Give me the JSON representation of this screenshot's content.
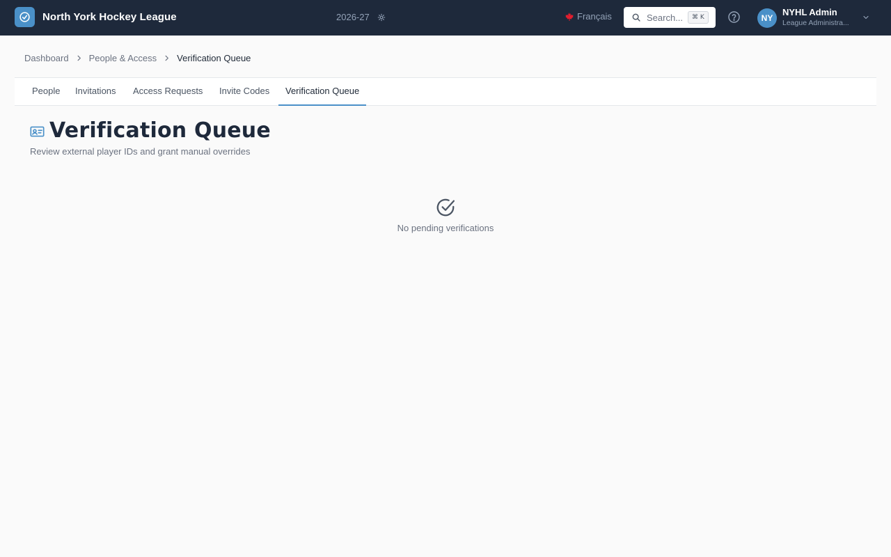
{
  "app": {
    "name": "North York Hockey League",
    "season": "2026-27",
    "language_toggle": "Français",
    "search_placeholder": "Search...",
    "search_shortcut": "⌘ K",
    "user": {
      "initials": "NY",
      "name": "NYHL Admin",
      "role": "League Administra..."
    }
  },
  "breadcrumb": [
    {
      "label": "Dashboard"
    },
    {
      "label": "People & Access"
    },
    {
      "label": "Verification Queue"
    }
  ],
  "tabs": [
    {
      "label": "People",
      "active": false
    },
    {
      "label": "Invitations",
      "active": false
    },
    {
      "label": "Access Requests",
      "active": false
    },
    {
      "label": "Invite Codes",
      "active": false
    },
    {
      "label": "Verification Queue",
      "active": true
    }
  ],
  "page": {
    "title": "Verification Queue",
    "subtitle": "Review external player IDs and grant manual overrides",
    "icon": "id-card-icon"
  },
  "empty_state": {
    "icon": "check-circle-icon",
    "message": "No pending verifications"
  },
  "colors": {
    "topbar_bg": "#1e293b",
    "accent": "#4a90c8",
    "page_bg": "#fafafa"
  }
}
